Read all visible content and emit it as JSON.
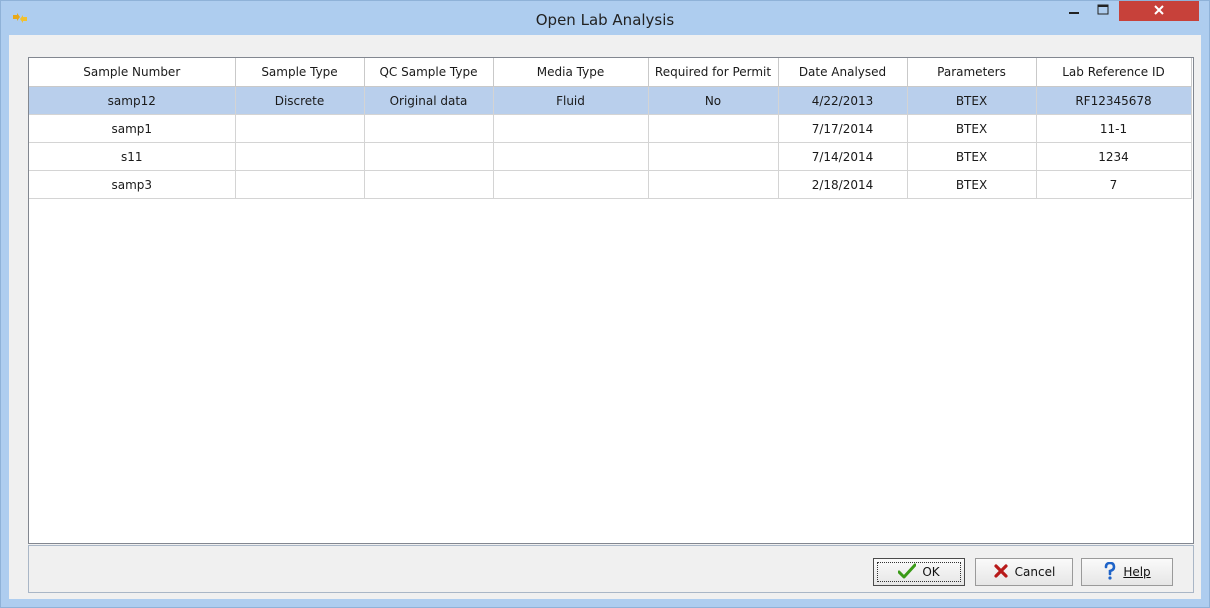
{
  "window": {
    "title": "Open Lab Analysis",
    "app_icon": "app-logo-icon",
    "controls": [
      "minimize-icon",
      "maximize-icon",
      "close-icon"
    ]
  },
  "grid": {
    "columns": [
      "Sample Number",
      "Sample Type",
      "QC Sample Type",
      "Media Type",
      "Required for Permit",
      "Date Analysed",
      "Parameters",
      "Lab Reference ID"
    ],
    "rows": [
      [
        "samp12",
        "Discrete",
        "Original data",
        "Fluid",
        "No",
        "4/22/2013",
        "BTEX",
        "RF12345678"
      ],
      [
        "samp1",
        "",
        "",
        "",
        "",
        "7/17/2014",
        "BTEX",
        "11-1"
      ],
      [
        "s11",
        "",
        "",
        "",
        "",
        "7/14/2014",
        "BTEX",
        "1234"
      ],
      [
        "samp3",
        "",
        "",
        "",
        "",
        "2/18/2014",
        "BTEX",
        "7"
      ]
    ],
    "selected_row": 0,
    "selected_color": "#b9cfec"
  },
  "buttons": {
    "ok_label": "OK",
    "cancel_label": "Cancel",
    "help_label": "Help",
    "ok_icon": "checkmark-icon",
    "cancel_icon": "x-icon",
    "help_icon": "question-mark-icon"
  },
  "colors": {
    "title_bar": "#aecdef",
    "close_button": "#c7413a",
    "ok_icon": "#3a9a17",
    "cancel_icon": "#b81a1a",
    "help_icon": "#1e63c8"
  }
}
